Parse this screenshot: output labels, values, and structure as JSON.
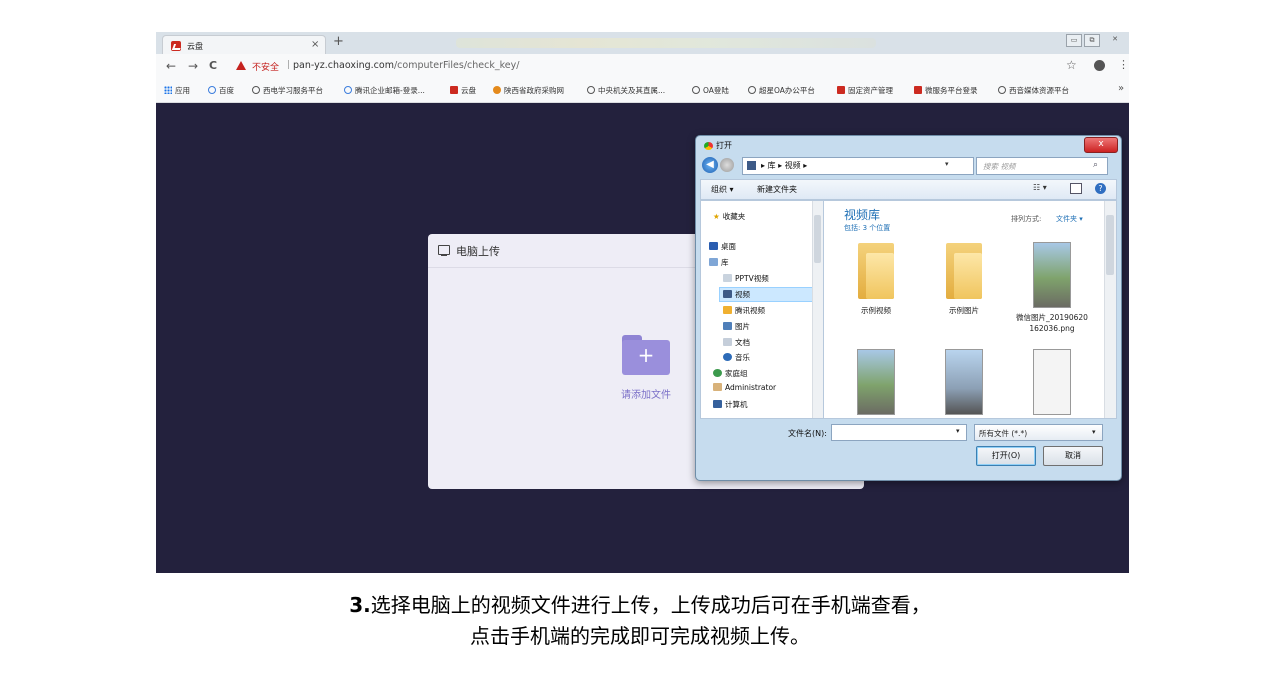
{
  "browser": {
    "tab_title": "云盘",
    "tab_close": "×",
    "new_tab": "+",
    "window_controls": [
      "▭",
      "⧉",
      "✕"
    ],
    "nav": {
      "back": "←",
      "forward": "→",
      "reload": "C"
    },
    "insecure_label": "不安全",
    "separator": "|",
    "url_host": "pan-yz.chaoxing.com",
    "url_path": "/computerFiles/check_key/",
    "star": "☆",
    "menu": "⋮",
    "bookmarks_more": "»",
    "bookmarks": [
      {
        "label": "应用",
        "icon": "apps-grid-icon"
      },
      {
        "label": "百度",
        "icon": "baidu-icon"
      },
      {
        "label": "西电学习服务平台",
        "icon": "globe-icon"
      },
      {
        "label": "腾讯企业邮箱-登录...",
        "icon": "mail-icon"
      },
      {
        "label": "云盘",
        "icon": "cloud-disk-icon"
      },
      {
        "label": "陕西省政府采购网",
        "icon": "emblem-icon"
      },
      {
        "label": "中央机关及其直属...",
        "icon": "globe-icon"
      },
      {
        "label": "OA登陆",
        "icon": "globe-icon"
      },
      {
        "label": "超星OA办公平台",
        "icon": "globe-icon"
      },
      {
        "label": "固定资产管理",
        "icon": "chaoxing-icon"
      },
      {
        "label": "微服务平台登录",
        "icon": "chaoxing-icon"
      },
      {
        "label": "西音媒体资源平台",
        "icon": "globe-icon"
      }
    ]
  },
  "upload_panel": {
    "title": "电脑上传",
    "add_file_label": "请添加文件",
    "plus": "+"
  },
  "open_dialog": {
    "title": "打开",
    "close": "x",
    "back": "◀",
    "path": "▸ 库 ▸ 视频 ▸",
    "path_drop": "▾",
    "refresh": "⟲",
    "search_placeholder": "搜索 视频",
    "search_icon": "⌕",
    "toolbar": {
      "organize": "组织 ▾",
      "new_folder": "新建文件夹",
      "view": "☷ ▾",
      "help": "?"
    },
    "tree": [
      {
        "label": "收藏夹",
        "icon": "star-icon"
      },
      {
        "label": "桌面",
        "icon": "desktop-icon"
      },
      {
        "label": "库",
        "icon": "library-icon"
      },
      {
        "label": "PPTV视频",
        "icon": "folder-icon"
      },
      {
        "label": "视频",
        "icon": "video-icon",
        "selected": true
      },
      {
        "label": "腾讯视频",
        "icon": "folder-icon"
      },
      {
        "label": "图片",
        "icon": "pictures-icon"
      },
      {
        "label": "文档",
        "icon": "documents-icon"
      },
      {
        "label": "音乐",
        "icon": "music-icon"
      },
      {
        "label": "家庭组",
        "icon": "homegroup-icon"
      },
      {
        "label": "Administrator",
        "icon": "user-icon"
      },
      {
        "label": "计算机",
        "icon": "computer-icon"
      }
    ],
    "library_title": "视频库",
    "library_subtitle": "包括: 3 个位置",
    "sort_label": "排列方式:",
    "sort_value": "文件夹 ▾",
    "files": [
      {
        "name": "示例视频",
        "type": "folder"
      },
      {
        "name": "示例图片",
        "type": "folder"
      },
      {
        "name": "微信图片_20190620162036.png",
        "type": "image"
      },
      {
        "name": "",
        "type": "image"
      },
      {
        "name": "",
        "type": "image"
      },
      {
        "name": "",
        "type": "image-white"
      }
    ],
    "filename_label": "文件名(N):",
    "filename_value": "",
    "filetype": "所有文件 (*.*)",
    "drop": "▾",
    "open_button": "打开(O)",
    "cancel_button": "取消"
  },
  "caption": {
    "step": "3.",
    "line1": "选择电脑上的视频文件进行上传，上传成功后可在手机端查看，",
    "line2": "点击手机端的完成即可完成视频上传。"
  }
}
